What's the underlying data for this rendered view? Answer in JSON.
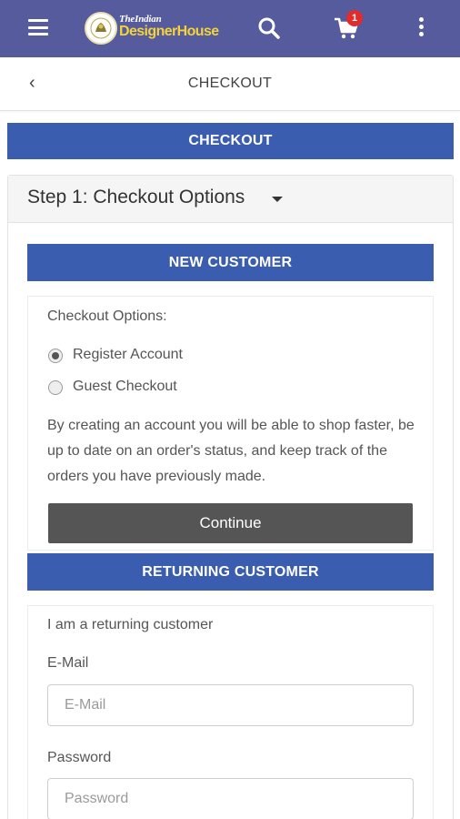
{
  "appbar": {
    "logo_small": "TheIndian",
    "logo_big": "DesignerHouse",
    "cart_count": "1",
    "icons": [
      "menu-icon",
      "search-icon",
      "cart-icon",
      "more-vertical-icon"
    ],
    "color": "#555b9d"
  },
  "subbar": {
    "back_glyph": "‹",
    "title": "CHECKOUT"
  },
  "checkout_banner": "CHECKOUT",
  "step": {
    "title": "Step 1: Checkout Options"
  },
  "new_customer": {
    "heading": "NEW CUSTOMER",
    "options_label": "Checkout Options:",
    "options": [
      {
        "label": "Register Account",
        "selected": true
      },
      {
        "label": "Guest Checkout",
        "selected": false
      }
    ],
    "description": "By creating an account you will be able to shop faster, be up to date on an order's status, and keep track of the orders you have previously made.",
    "continue_label": "Continue"
  },
  "returning_customer": {
    "heading": "RETURNING CUSTOMER",
    "intro": "I am a returning customer",
    "email_label": "E-Mail",
    "email_placeholder": "E-Mail",
    "password_label": "Password",
    "password_placeholder": "Password"
  },
  "colors": {
    "banner": "#3a5db0",
    "button": "#555555",
    "badge": "#e22b2b",
    "logo_text": "#f3d23a"
  }
}
